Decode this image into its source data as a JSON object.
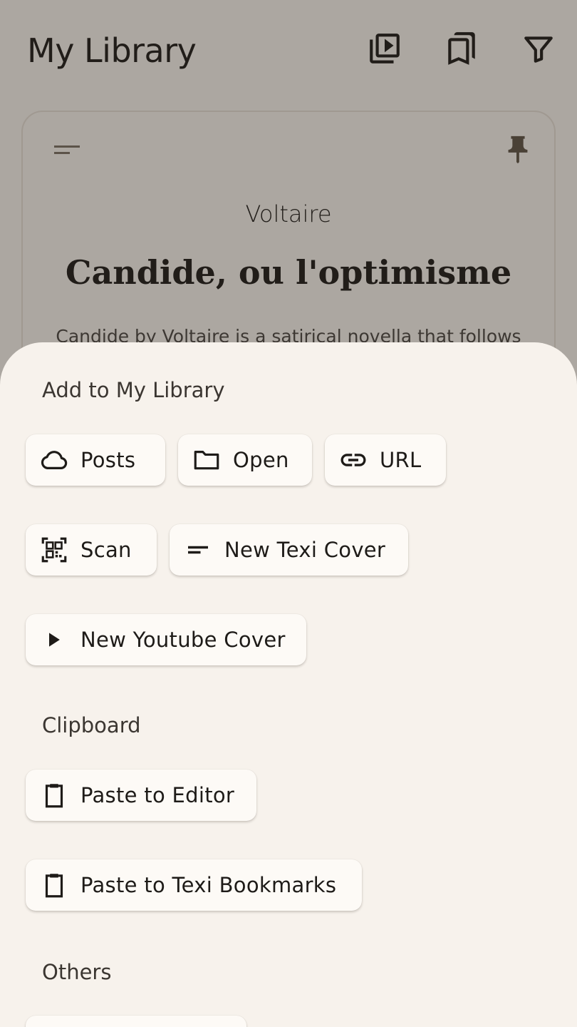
{
  "header": {
    "title": "My Library",
    "actions": [
      {
        "icon": "video-library-icon"
      },
      {
        "icon": "bookmarks-icon"
      },
      {
        "icon": "filter-icon"
      }
    ]
  },
  "cover": {
    "author": "Voltaire",
    "title": "Candide, ou l'optimisme",
    "description": "Candide by Voltaire is a satirical novella that follows",
    "icons": [
      "short-text-icon",
      "pin-icon"
    ]
  },
  "sheet": {
    "sections": {
      "add": "Add to My Library",
      "clipboard": "Clipboard",
      "others": "Others"
    },
    "add_items": {
      "posts": "Posts",
      "open": "Open",
      "url": "URL",
      "scan": "Scan",
      "new_texi_cover": "New Texi Cover",
      "new_youtube_cover": "New Youtube Cover"
    },
    "clipboard_items": {
      "paste_editor": "Paste to Editor",
      "paste_bookmarks": "Paste to Texi Bookmarks"
    }
  },
  "colors": {
    "background": "#f7f2ec",
    "chip": "#fdfaf6",
    "text": "#1e1b18",
    "scrim": "rgba(40,34,28,0.36)"
  }
}
